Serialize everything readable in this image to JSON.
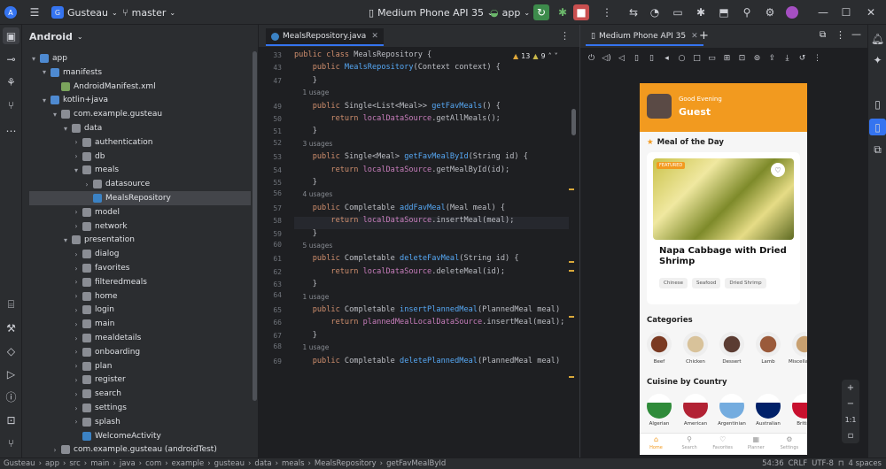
{
  "titlebar": {
    "project_badge": "G",
    "project": "Gusteau",
    "branch": "master",
    "device": "Medium Phone API 35",
    "config": "app"
  },
  "project_panel": {
    "title": "Android",
    "items": [
      {
        "label": "app",
        "depth": 0,
        "open": "▾",
        "color": "#4e8ad1"
      },
      {
        "label": "manifests",
        "depth": 1,
        "open": "▾",
        "color": "#4e8ad1"
      },
      {
        "label": "AndroidManifest.xml",
        "depth": 2,
        "open": "",
        "color": "#7aa35c"
      },
      {
        "label": "kotlin+java",
        "depth": 1,
        "open": "▾",
        "color": "#4e8ad1"
      },
      {
        "label": "com.example.gusteau",
        "depth": 2,
        "open": "▾",
        "color": "#8a8d94"
      },
      {
        "label": "data",
        "depth": 3,
        "open": "▾",
        "color": "#8a8d94"
      },
      {
        "label": "authentication",
        "depth": 4,
        "open": "›",
        "color": "#8a8d94"
      },
      {
        "label": "db",
        "depth": 4,
        "open": "›",
        "color": "#8a8d94"
      },
      {
        "label": "meals",
        "depth": 4,
        "open": "▾",
        "color": "#8a8d94"
      },
      {
        "label": "datasource",
        "depth": 5,
        "open": "›",
        "color": "#8a8d94"
      },
      {
        "label": "MealsRepository",
        "depth": 5,
        "open": "",
        "color": "#3b82c4"
      },
      {
        "label": "model",
        "depth": 4,
        "open": "›",
        "color": "#8a8d94"
      },
      {
        "label": "network",
        "depth": 4,
        "open": "›",
        "color": "#8a8d94"
      },
      {
        "label": "presentation",
        "depth": 3,
        "open": "▾",
        "color": "#8a8d94"
      },
      {
        "label": "dialog",
        "depth": 4,
        "open": "›",
        "color": "#8a8d94"
      },
      {
        "label": "favorites",
        "depth": 4,
        "open": "›",
        "color": "#8a8d94"
      },
      {
        "label": "filteredmeals",
        "depth": 4,
        "open": "›",
        "color": "#8a8d94"
      },
      {
        "label": "home",
        "depth": 4,
        "open": "›",
        "color": "#8a8d94"
      },
      {
        "label": "login",
        "depth": 4,
        "open": "›",
        "color": "#8a8d94"
      },
      {
        "label": "main",
        "depth": 4,
        "open": "›",
        "color": "#8a8d94"
      },
      {
        "label": "mealdetails",
        "depth": 4,
        "open": "›",
        "color": "#8a8d94"
      },
      {
        "label": "onboarding",
        "depth": 4,
        "open": "›",
        "color": "#8a8d94"
      },
      {
        "label": "plan",
        "depth": 4,
        "open": "›",
        "color": "#8a8d94"
      },
      {
        "label": "register",
        "depth": 4,
        "open": "›",
        "color": "#8a8d94"
      },
      {
        "label": "search",
        "depth": 4,
        "open": "›",
        "color": "#8a8d94"
      },
      {
        "label": "settings",
        "depth": 4,
        "open": "›",
        "color": "#8a8d94"
      },
      {
        "label": "splash",
        "depth": 4,
        "open": "›",
        "color": "#8a8d94"
      },
      {
        "label": "WelcomeActivity",
        "depth": 4,
        "open": "",
        "color": "#3b82c4"
      },
      {
        "label": "com.example.gusteau (androidTest)",
        "depth": 2,
        "open": "›",
        "color": "#8a8d94"
      }
    ],
    "selected": 10
  },
  "editor": {
    "tab": "MealsRepository.java",
    "warnings": "13",
    "weak": "9",
    "lines": [
      {
        "n": "33",
        "t": [
          [
            "kw",
            "public class "
          ],
          [
            "",
            "MealsRepository {"
          ]
        ]
      },
      {
        "n": "43",
        "t": [
          [
            "",
            "    "
          ],
          [
            "kw",
            "public "
          ],
          [
            "fn",
            "MealsRepository"
          ],
          [
            "",
            "(Context context) {"
          ]
        ]
      },
      {
        "n": "47",
        "t": [
          [
            "",
            "    }"
          ]
        ]
      },
      {
        "n": "",
        "t": [
          [
            "hint",
            "    1 usage"
          ]
        ]
      },
      {
        "n": "49",
        "t": [
          [
            "",
            "    "
          ],
          [
            "kw",
            "public "
          ],
          [
            "",
            "Single<List<Meal>> "
          ],
          [
            "fn",
            "getFavMeals"
          ],
          [
            "",
            "() {"
          ]
        ]
      },
      {
        "n": "50",
        "t": [
          [
            "",
            "        "
          ],
          [
            "kw",
            "return "
          ],
          [
            "fld",
            "localDataSource"
          ],
          [
            "",
            ".getAllMeals();"
          ]
        ]
      },
      {
        "n": "51",
        "t": [
          [
            "",
            "    }"
          ]
        ]
      },
      {
        "n": "",
        "t": [
          [
            "hint",
            "    3 usages"
          ]
        ]
      },
      {
        "n": "53",
        "t": [
          [
            "",
            "    "
          ],
          [
            "kw",
            "public "
          ],
          [
            "",
            "Single<Meal> "
          ],
          [
            "fn",
            "getFavMealById"
          ],
          [
            "",
            "(String id) {"
          ]
        ]
      },
      {
        "n": "54",
        "t": [
          [
            "",
            "        "
          ],
          [
            "kw",
            "return "
          ],
          [
            "fld",
            "localDataSource"
          ],
          [
            "",
            ".getMealById(id);"
          ]
        ]
      },
      {
        "n": "55",
        "t": [
          [
            "",
            "    }"
          ]
        ]
      },
      {
        "n": "",
        "t": [
          [
            "hint",
            "    4 usages"
          ]
        ]
      },
      {
        "n": "57",
        "t": [
          [
            "",
            "    "
          ],
          [
            "kw",
            "public "
          ],
          [
            "",
            "Completable "
          ],
          [
            "fn",
            "addFavMeal"
          ],
          [
            "",
            "(Meal meal) {"
          ]
        ]
      },
      {
        "n": "58",
        "t": [
          [
            "",
            "        "
          ],
          [
            "kw",
            "return "
          ],
          [
            "fld",
            "localDataSource"
          ],
          [
            "",
            ".insertMeal(meal);"
          ]
        ]
      },
      {
        "n": "59",
        "t": [
          [
            "",
            "    }"
          ]
        ]
      },
      {
        "n": "",
        "t": [
          [
            "hint",
            "    5 usages"
          ]
        ]
      },
      {
        "n": "61",
        "t": [
          [
            "",
            "    "
          ],
          [
            "kw",
            "public "
          ],
          [
            "",
            "Completable "
          ],
          [
            "fn",
            "deleteFavMeal"
          ],
          [
            "",
            "(String id) {"
          ]
        ]
      },
      {
        "n": "62",
        "t": [
          [
            "",
            "        "
          ],
          [
            "kw",
            "return "
          ],
          [
            "fld",
            "localDataSource"
          ],
          [
            "",
            ".deleteMeal(id);"
          ]
        ]
      },
      {
        "n": "63",
        "t": [
          [
            "",
            "    }"
          ]
        ]
      },
      {
        "n": "",
        "t": [
          [
            "hint",
            "    1 usage"
          ]
        ]
      },
      {
        "n": "65",
        "t": [
          [
            "",
            "    "
          ],
          [
            "kw",
            "public "
          ],
          [
            "",
            "Completable "
          ],
          [
            "fn",
            "insertPlannedMeal"
          ],
          [
            "",
            "(PlannedMeal meal)"
          ]
        ]
      },
      {
        "n": "66",
        "t": [
          [
            "",
            "        "
          ],
          [
            "kw",
            "return "
          ],
          [
            "fld",
            "plannedMealLocalDataSource"
          ],
          [
            "",
            ".insertMeal(meal);"
          ]
        ]
      },
      {
        "n": "67",
        "t": [
          [
            "",
            "    }"
          ]
        ]
      },
      {
        "n": "",
        "t": [
          [
            "hint",
            "    1 usage"
          ]
        ]
      },
      {
        "n": "69",
        "t": [
          [
            "",
            "    "
          ],
          [
            "kw",
            "public "
          ],
          [
            "",
            "Completable "
          ],
          [
            "fn",
            "deletePlannedMeal"
          ],
          [
            "",
            "(PlannedMeal meal)"
          ]
        ]
      }
    ],
    "extra_line_numbers": [
      "52",
      "56",
      "60",
      "64",
      "68"
    ]
  },
  "device": {
    "tab": "Medium Phone API 35",
    "app": {
      "greeting": "Good Evening",
      "user": "Guest",
      "meal_of_day": "Meal of the Day",
      "featured": "FEATURED",
      "meal_title": "Napa Cabbage with Dried Shrimp",
      "tags": [
        "Chinese",
        "Seafood",
        "Dried Shrimp"
      ],
      "categories_title": "Categories",
      "categories": [
        {
          "label": "Beef",
          "color": "#7a3a22"
        },
        {
          "label": "Chicken",
          "color": "#d8c29a"
        },
        {
          "label": "Dessert",
          "color": "#5b3c32"
        },
        {
          "label": "Lamb",
          "color": "#9a5a3a"
        },
        {
          "label": "Miscellaneous",
          "color": "#c8a070"
        }
      ],
      "countries_title": "Cuisine by Country",
      "countries": [
        {
          "label": "Algerian",
          "color": "#2f8b3a"
        },
        {
          "label": "American",
          "color": "#b22234"
        },
        {
          "label": "Argentinian",
          "color": "#74acdf"
        },
        {
          "label": "Australian",
          "color": "#012169"
        },
        {
          "label": "British",
          "color": "#c8102e"
        }
      ],
      "nav": [
        {
          "label": "Home",
          "glyph": "⌂"
        },
        {
          "label": "Search",
          "glyph": "⚲"
        },
        {
          "label": "Favorites",
          "glyph": "♡"
        },
        {
          "label": "Planner",
          "glyph": "▦"
        },
        {
          "label": "Settings",
          "glyph": "⚙"
        }
      ]
    },
    "zoom": [
      "+",
      "−",
      "1:1",
      "▫"
    ]
  },
  "status": {
    "crumbs": [
      "Gusteau",
      "app",
      "src",
      "main",
      "java",
      "com",
      "example",
      "gusteau",
      "data",
      "meals",
      "MealsRepository",
      "getFavMealById"
    ],
    "position": "54:36",
    "line_ending": "CRLF",
    "encoding": "UTF-8",
    "indent": "4 spaces"
  }
}
